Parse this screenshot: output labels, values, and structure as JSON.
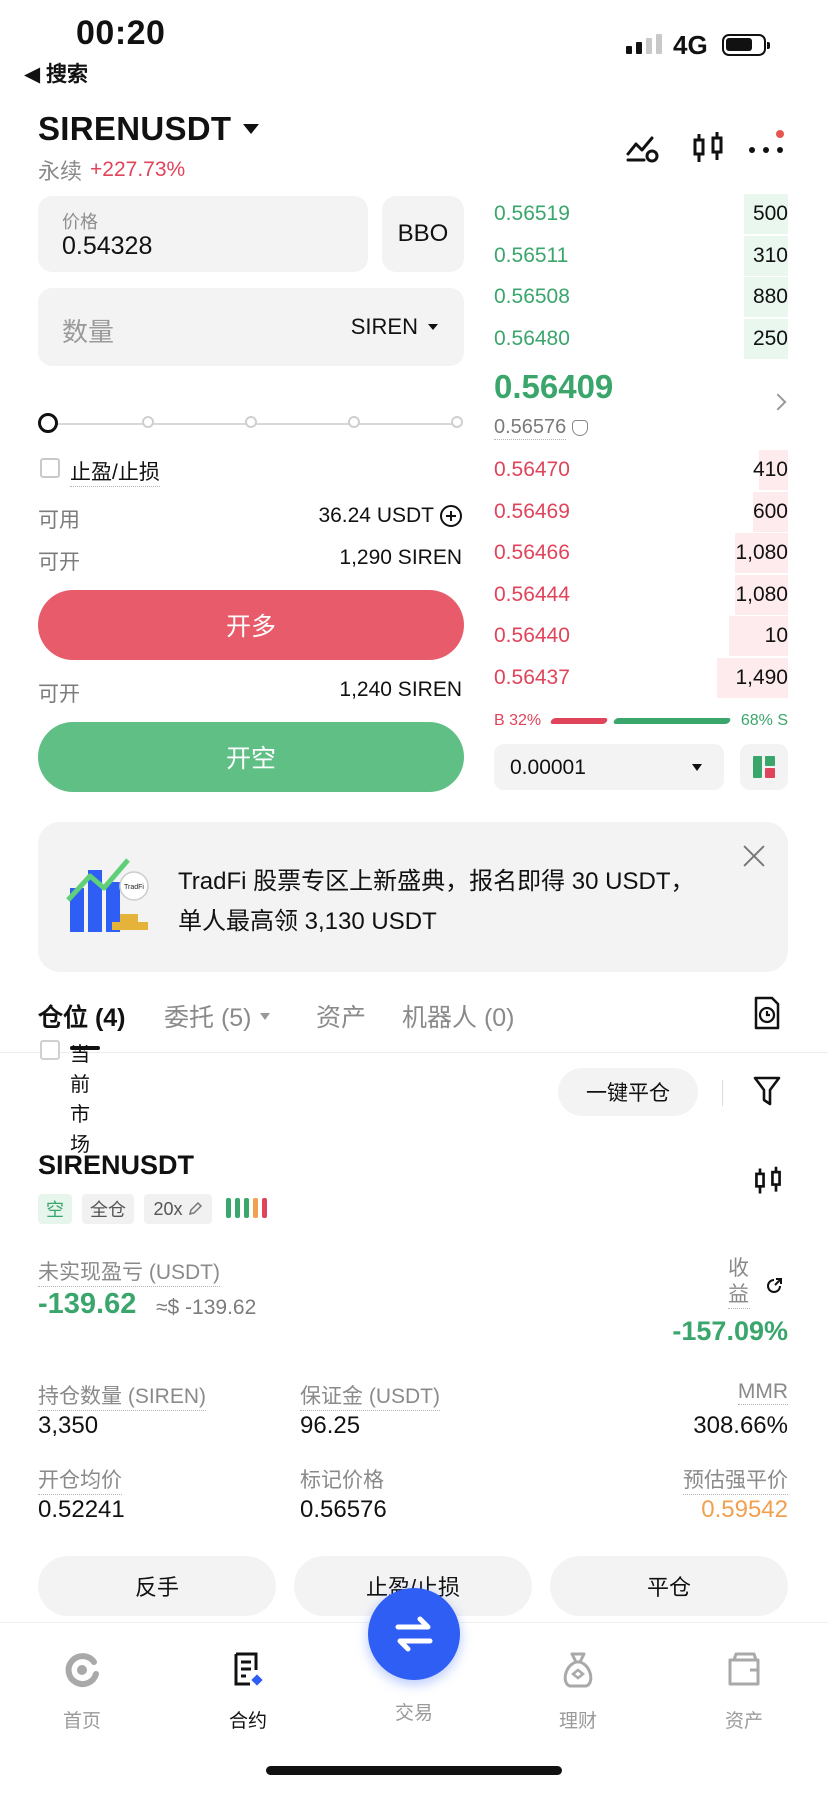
{
  "status_bar": {
    "time": "00:20",
    "back_label": "◀ 搜索",
    "network": "4G"
  },
  "header": {
    "pair": "SIRENUSDT",
    "contract_type": "永续",
    "change": "+227.73%"
  },
  "order_form": {
    "price_label": "价格",
    "price_value": "0.54328",
    "bbo_label": "BBO",
    "quantity_placeholder": "数量",
    "quantity_unit": "SIREN",
    "tpsl_label": "止盈/止损",
    "available_label": "可用",
    "available_value": "36.24 USDT",
    "open_label": "可开",
    "open_long_value": "1,290 SIREN",
    "open_long_button": "开多",
    "open_short_value": "1,240 SIREN",
    "open_short_button": "开空",
    "slider_value": 0
  },
  "orderbook": {
    "asks": [
      {
        "price": "0.56519",
        "qty": "500",
        "depth": 0.15
      },
      {
        "price": "0.56511",
        "qty": "310",
        "depth": 0.15
      },
      {
        "price": "0.56508",
        "qty": "880",
        "depth": 0.15
      },
      {
        "price": "0.56480",
        "qty": "250",
        "depth": 0.15
      }
    ],
    "last_price": "0.56409",
    "mark_price": "0.56576",
    "bids": [
      {
        "price": "0.56470",
        "qty": "410",
        "depth": 0.1
      },
      {
        "price": "0.56469",
        "qty": "600",
        "depth": 0.12
      },
      {
        "price": "0.56466",
        "qty": "1,080",
        "depth": 0.18
      },
      {
        "price": "0.56444",
        "qty": "1,080",
        "depth": 0.18
      },
      {
        "price": "0.56440",
        "qty": "10",
        "depth": 0.2
      },
      {
        "price": "0.56437",
        "qty": "1,490",
        "depth": 0.24
      }
    ],
    "buy_ratio": "B 32%",
    "sell_ratio": "68% S",
    "precision": "0.00001"
  },
  "banner": {
    "text": "TradFi 股票专区上新盛典，报名即得 30 USDT，单人最高领 3,130 USDT",
    "logo_text": "TradFi"
  },
  "tabs": {
    "positions": "仓位 (4)",
    "orders": "委托 (5)",
    "assets": "资产",
    "bots": "机器人 (0)"
  },
  "filter": {
    "current_market": "当前市场",
    "close_all": "一键平仓"
  },
  "position": {
    "symbol": "SIRENUSDT",
    "side": "空",
    "margin_mode": "全仓",
    "leverage": "20x",
    "unrealized_pnl_label": "未实现盈亏 (USDT)",
    "unrealized_pnl": "-139.62",
    "unrealized_pnl_usd": "≈$ -139.62",
    "roe_label": "收益",
    "roe": "-157.09%",
    "size_label": "持仓数量 (SIREN)",
    "size": "3,350",
    "margin_label": "保证金 (USDT)",
    "margin": "96.25",
    "mmr_label": "MMR",
    "mmr": "308.66%",
    "entry_label": "开仓均价",
    "entry": "0.52241",
    "mark_label": "标记价格",
    "mark": "0.56576",
    "liq_label": "预估强平价",
    "liq": "0.59542",
    "btn_reverse": "反手",
    "btn_tpsl": "止盈/止损",
    "btn_close": "平仓"
  },
  "nav": {
    "home": "首页",
    "futures": "合约",
    "trade": "交易",
    "finance": "理财",
    "assets": "资产"
  },
  "colors": {
    "green": "#3aa66c",
    "red": "#e0445a",
    "long_button": "#e75b6b",
    "short_button": "#5fbf85",
    "liq_orange": "#f0a050",
    "fab_blue": "#2f5ef5"
  }
}
